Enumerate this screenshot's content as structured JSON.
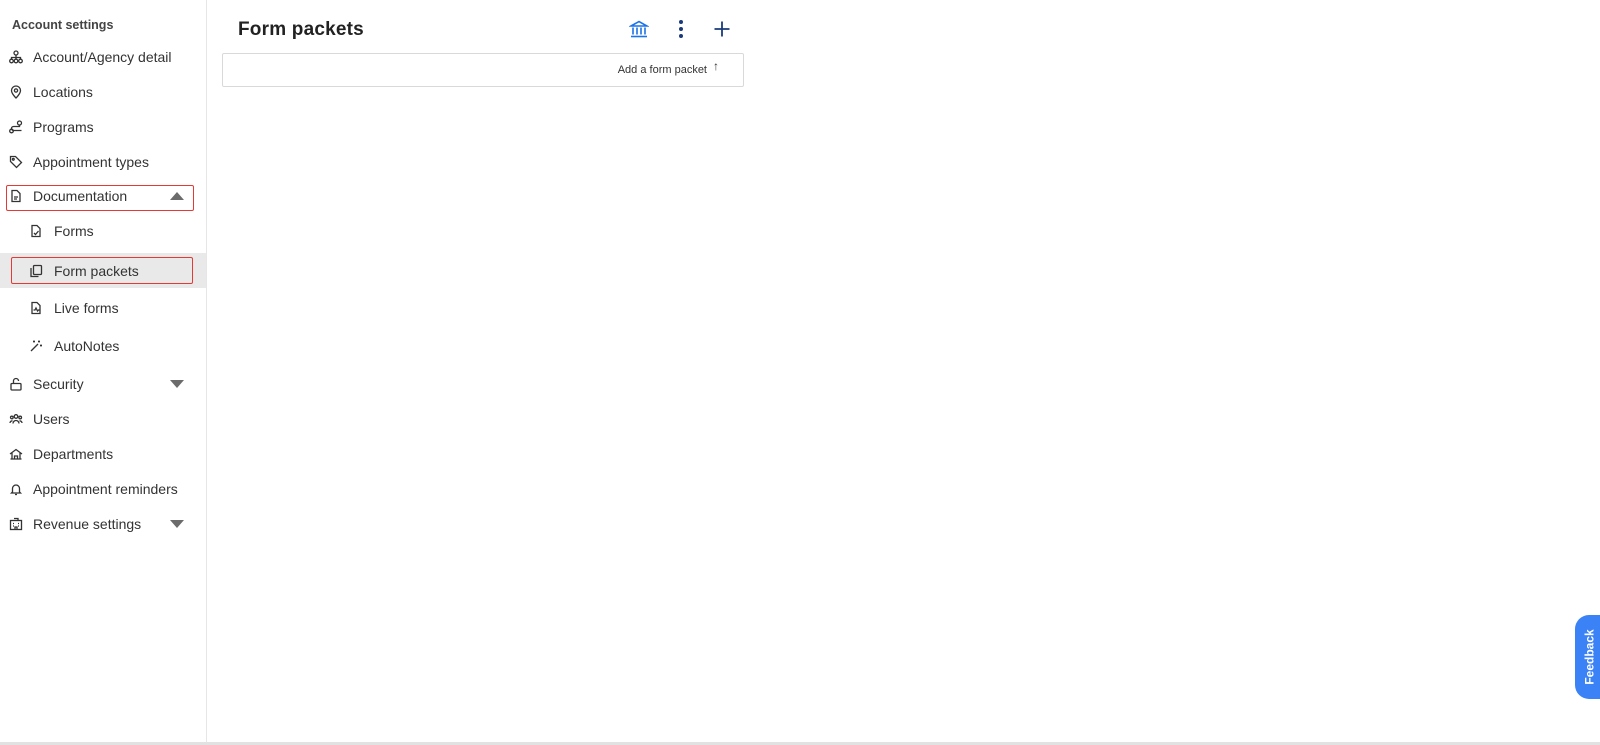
{
  "sidebar": {
    "heading": "Account settings",
    "items": [
      {
        "label": "Account/Agency detail",
        "icon": "org-chart-icon"
      },
      {
        "label": "Locations",
        "icon": "location-pin-icon"
      },
      {
        "label": "Programs",
        "icon": "route-icon"
      },
      {
        "label": "Appointment types",
        "icon": "tag-icon"
      },
      {
        "label": "Documentation",
        "icon": "document-icon",
        "expanded": true
      },
      {
        "label": "Forms",
        "icon": "form-doc-icon"
      },
      {
        "label": "Form packets",
        "icon": "copy-stack-icon",
        "active": true
      },
      {
        "label": "Live forms",
        "icon": "live-doc-icon"
      },
      {
        "label": "AutoNotes",
        "icon": "magic-wand-icon"
      },
      {
        "label": "Security",
        "icon": "unlock-icon",
        "expanded": false
      },
      {
        "label": "Users",
        "icon": "users-icon"
      },
      {
        "label": "Departments",
        "icon": "department-icon"
      },
      {
        "label": "Appointment reminders",
        "icon": "bell-icon"
      },
      {
        "label": "Revenue settings",
        "icon": "building-icon",
        "expanded": false
      }
    ]
  },
  "main": {
    "title": "Form packets",
    "toolbar": {
      "library_icon": "bank-icon",
      "more_icon": "more-vertical-icon",
      "add_icon": "plus-icon"
    },
    "add_packet_label": "Add a form packet",
    "sort_icon": "sort-arrow-icon"
  },
  "feedback": {
    "label": "Feedback"
  },
  "colors": {
    "accent_blue": "#1a73e8",
    "highlight_red": "#e53935",
    "feedback_blue": "#3b82f6",
    "active_bg": "#e9e9e9"
  }
}
